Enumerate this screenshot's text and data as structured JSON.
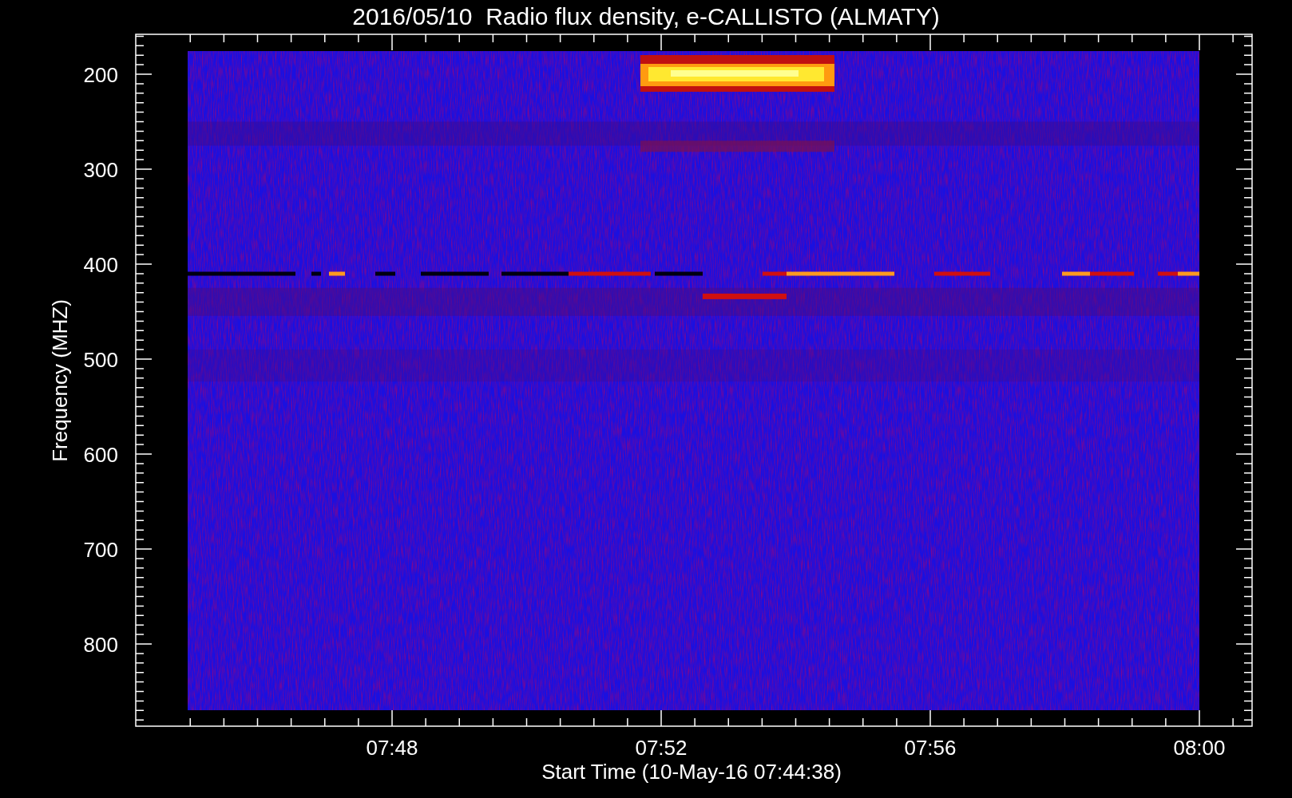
{
  "title": "2016/05/10  Radio flux density, e-CALLISTO (ALMATY)",
  "xlabel": "Start Time (10-May-16 07:44:38)",
  "ylabel": "Frequency (MHZ)",
  "xticks": [
    "07:48",
    "07:52",
    "07:56",
    "08:00"
  ],
  "yticks": [
    "200",
    "300",
    "400",
    "500",
    "600",
    "700",
    "800"
  ]
}
